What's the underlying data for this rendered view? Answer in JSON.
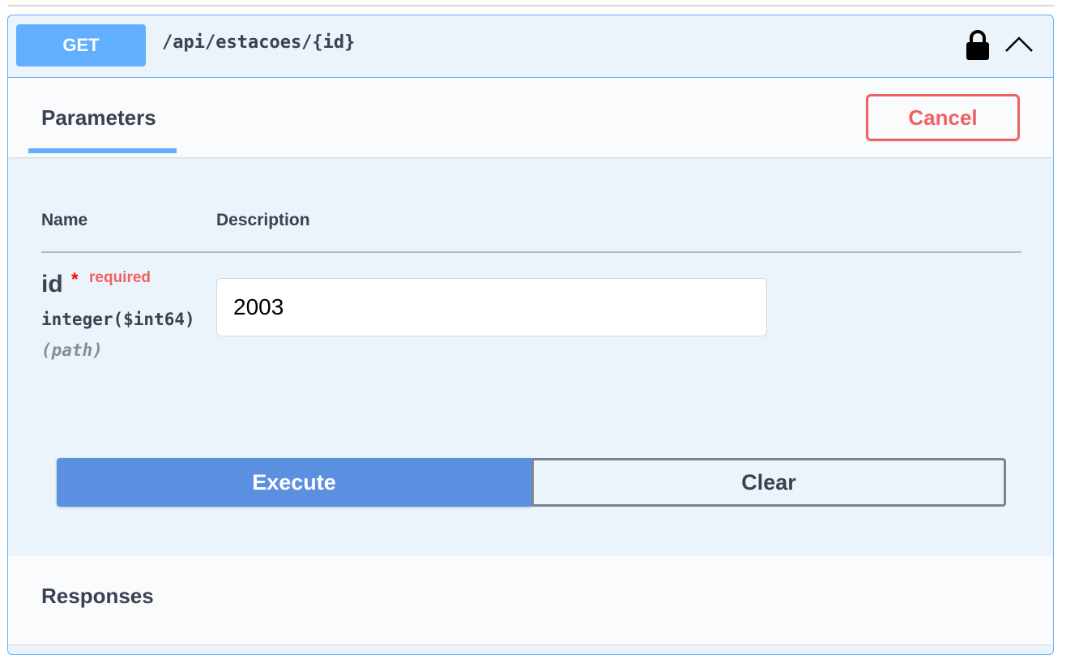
{
  "endpoint": {
    "method": "GET",
    "path": "/api/estacoes/{id}",
    "icons": {
      "lock": "lock-icon",
      "collapse": "chevron-up-icon"
    }
  },
  "tabs": {
    "parameters_label": "Parameters",
    "cancel_label": "Cancel"
  },
  "parameters": {
    "columns": {
      "name": "Name",
      "description": "Description"
    },
    "items": [
      {
        "name": "id",
        "required_star": "*",
        "required_label": "required",
        "type": "integer($int64)",
        "in": "(path)",
        "value": "2003"
      }
    ]
  },
  "actions": {
    "execute_label": "Execute",
    "clear_label": "Clear"
  },
  "responses": {
    "title": "Responses"
  },
  "colors": {
    "get_accent": "#61affe",
    "execute": "#5b8fdf",
    "cancel": "#f06262",
    "required": "#f06262",
    "block_background": "#ebf3fb"
  }
}
